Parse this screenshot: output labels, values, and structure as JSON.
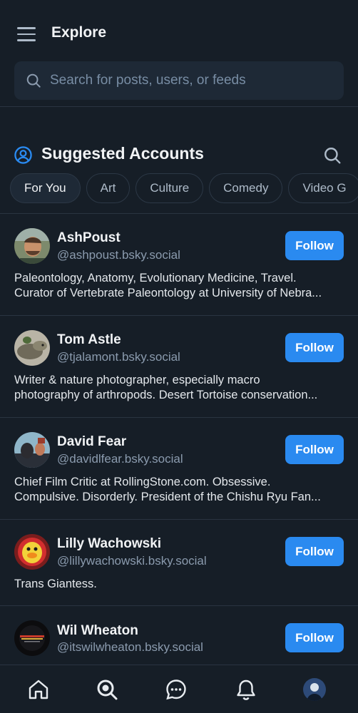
{
  "header": {
    "title": "Explore",
    "search_placeholder": "Search for posts, users, or feeds"
  },
  "section": {
    "title": "Suggested Accounts"
  },
  "chips": [
    "For You",
    "Art",
    "Culture",
    "Comedy",
    "Video G"
  ],
  "accounts": [
    {
      "name": "AshPoust",
      "handle": "@ashpoust.bsky.social",
      "bio_lines": [
        "Paleontology, Anatomy, Evolutionary Medicine, Travel.",
        "Curator of Vertebrate Paleontology at University of Nebra..."
      ],
      "follow_label": "Follow"
    },
    {
      "name": "Tom Astle",
      "handle": "@tjalamont.bsky.social",
      "bio_lines": [
        "Writer & nature photographer, especially macro",
        "photography of arthropods. Desert Tortoise conservation..."
      ],
      "follow_label": "Follow"
    },
    {
      "name": "David Fear",
      "handle": "@davidlfear.bsky.social",
      "bio_lines": [
        "Chief Film Critic at RollingStone.com. Obsessive.",
        "Compulsive. Disorderly. President of the Chishu Ryu Fan..."
      ],
      "follow_label": "Follow"
    },
    {
      "name": "Lilly Wachowski",
      "handle": "@lillywachowski.bsky.social",
      "bio_lines": [
        "Trans Giantess."
      ],
      "follow_label": "Follow"
    },
    {
      "name": "Wil Wheaton",
      "handle": "@itswilwheaton.bsky.social",
      "bio_lines": [],
      "follow_label": "Follow"
    }
  ],
  "tabs": [
    "home-icon",
    "search-icon",
    "chat-icon",
    "bell-icon",
    "profile-avatar"
  ],
  "colors": {
    "background": "#161e27",
    "accent": "#2a8af0",
    "muted_text": "#8b9bae",
    "surface": "#1e2936"
  }
}
